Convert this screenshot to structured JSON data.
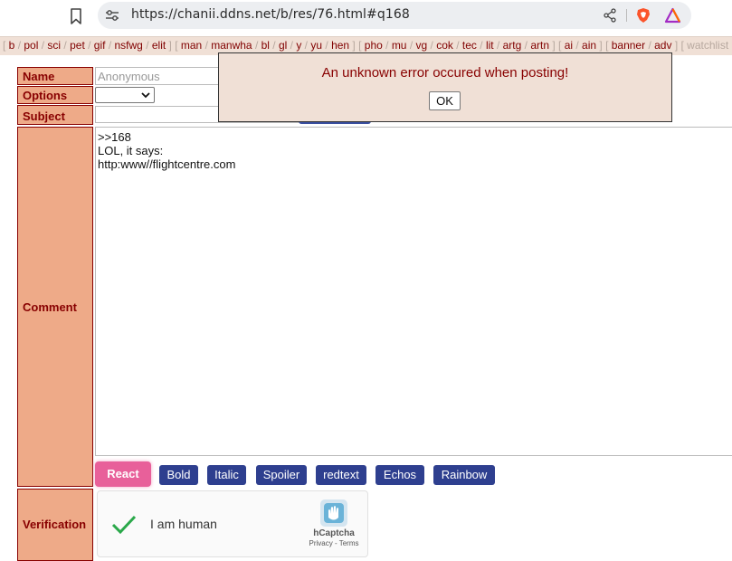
{
  "browser": {
    "url": "https://chanii.ddns.net/b/res/76.html#q168"
  },
  "boardnav": {
    "groups": [
      [
        "b",
        "pol",
        "sci",
        "pet",
        "gif",
        "nsfwg",
        "elit"
      ],
      [
        "man",
        "manwha",
        "bl",
        "gl",
        "y",
        "yu",
        "hen"
      ],
      [
        "pho",
        "mu",
        "vg",
        "cok",
        "tec",
        "lit",
        "artg",
        "artn"
      ],
      [
        "ai",
        "ain"
      ],
      [
        "banner",
        "adv"
      ]
    ],
    "tail": "] [ watchlist"
  },
  "form": {
    "name_label": "Name",
    "name_placeholder": "Anonymous",
    "options_label": "Options",
    "subject_label": "Subject",
    "comment_label": "Comment",
    "comment_text": ">>168\nLOL, it says:\nhttp:www//flightcentre.com",
    "verification_label": "Verification",
    "react_label": "React",
    "format_buttons": [
      "Bold",
      "Italic",
      "Spoiler",
      "redtext",
      "Echos",
      "Rainbow"
    ],
    "captcha_text": "I am human",
    "captcha_brand": "hCaptcha",
    "captcha_terms": "Privacy - Terms"
  },
  "dialog": {
    "message": "An unknown error occured when posting!",
    "ok_label": "OK"
  },
  "colors": {
    "label_bg": "#eeaa88",
    "label_text": "#800000",
    "button_blue": "#2e3f8f",
    "react_pink": "#e8609a"
  }
}
